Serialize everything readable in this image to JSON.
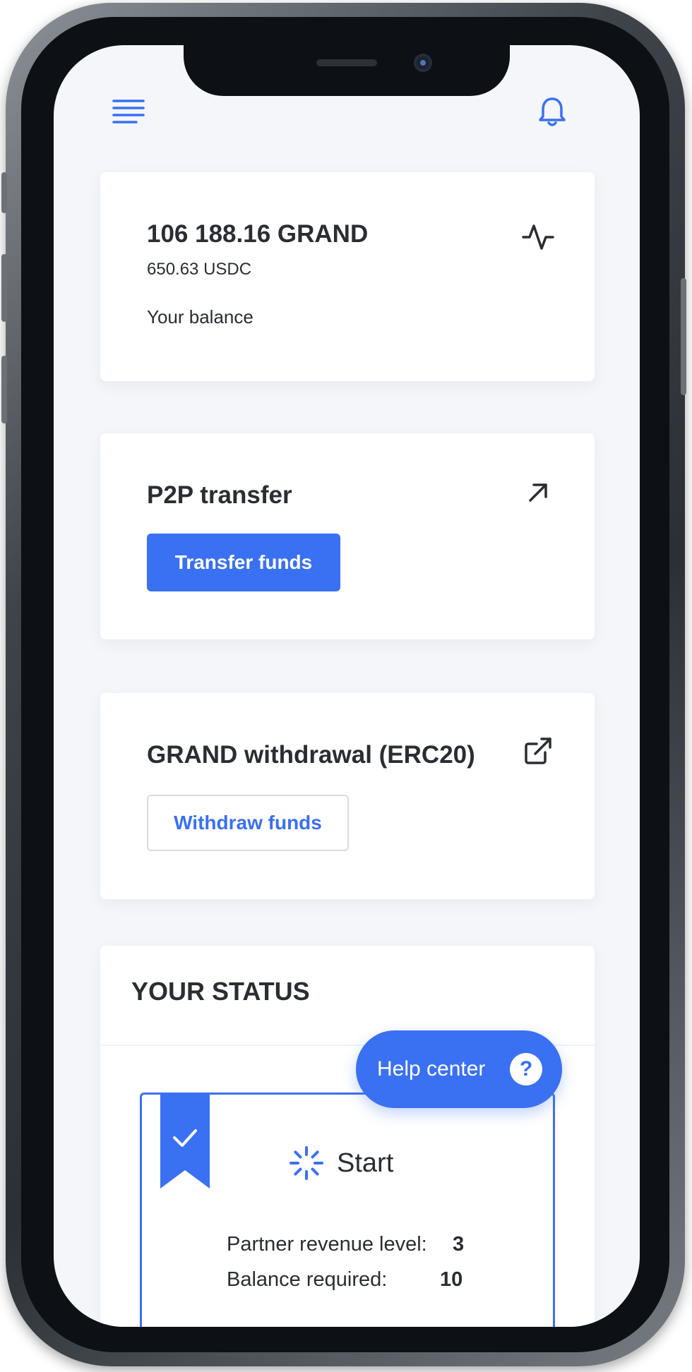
{
  "balance": {
    "amount": "106 188.16 GRAND",
    "usd_amount": "650.63 USDC",
    "label": "Your balance"
  },
  "p2p": {
    "title": "P2P transfer",
    "button_label": "Transfer funds"
  },
  "withdrawal": {
    "title": "GRAND withdrawal (ERC20)",
    "button_label": "Withdraw funds"
  },
  "status": {
    "title": "YOUR STATUS",
    "level_name": "Start",
    "partner_revenue_label": "Partner revenue level:",
    "partner_revenue_value": "3",
    "balance_required_label": "Balance required:",
    "balance_required_value": "10"
  },
  "help": {
    "label": "Help center",
    "icon_glyph": "?"
  },
  "colors": {
    "accent": "#3a70f2",
    "text": "#2a2d33",
    "background": "#f4f6f9"
  },
  "icons": [
    "menu-icon",
    "bell-icon",
    "activity-icon",
    "arrow-up-right-icon",
    "external-link-icon",
    "check-icon",
    "loader-icon",
    "question-icon"
  ]
}
